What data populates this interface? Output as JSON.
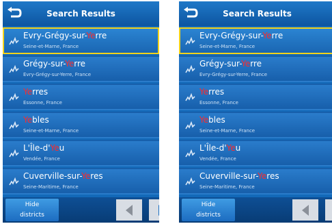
{
  "screens": [
    {
      "header": {
        "title": "Search Results",
        "back_icon": "back-arrow-icon"
      },
      "results": [
        {
          "name_before": "Evry-Grégy-sur-",
          "name_hl": "Ye",
          "name_after": "rre",
          "subtitle": "Seine-et-Marne, France",
          "selected": true,
          "icon": "city-icon"
        },
        {
          "name_before": "Grégy-sur-",
          "name_hl": "Ye",
          "name_after": "rre",
          "subtitle": "Evry-Grégy-sur-Yerre, France",
          "selected": false,
          "icon": "city-icon"
        },
        {
          "name_before": "",
          "name_hl": "Ye",
          "name_after": "rres",
          "subtitle": "Essonne, France",
          "selected": false,
          "icon": "city-icon"
        },
        {
          "name_before": "",
          "name_hl": "Ye",
          "name_after": "bles",
          "subtitle": "Seine-et-Marne, France",
          "selected": false,
          "icon": "city-icon"
        },
        {
          "name_before": "L'Île-d'",
          "name_hl": "Ye",
          "name_after": "u",
          "subtitle": "Vendée, France",
          "selected": false,
          "icon": "city-icon"
        },
        {
          "name_before": "Cuverville-sur-",
          "name_hl": "Ye",
          "name_after": "res",
          "subtitle": "Seine-Maritime, France",
          "selected": false,
          "icon": "city-icon"
        }
      ],
      "footer": {
        "hide_label_1": "Hide",
        "hide_label_2": "districts",
        "prev_icon": "left-arrow-icon",
        "next_icon": "right-arrow-icon"
      }
    },
    {
      "header": {
        "title": "Search Results",
        "back_icon": "back-arrow-icon"
      },
      "results": [
        {
          "name_before": "Evry-Grégy-sur-",
          "name_hl": "Ye",
          "name_after": "rre",
          "subtitle": "Seine-et-Marne, France",
          "selected": true,
          "icon": "city-icon"
        },
        {
          "name_before": "Grégy-sur-",
          "name_hl": "Ye",
          "name_after": "rre",
          "subtitle": "Evry-Grégy-sur-Yerre, France",
          "selected": false,
          "icon": "city-icon"
        },
        {
          "name_before": "",
          "name_hl": "Ye",
          "name_after": "rres",
          "subtitle": "Essonne, France",
          "selected": false,
          "icon": "city-icon"
        },
        {
          "name_before": "",
          "name_hl": "Ye",
          "name_after": "bles",
          "subtitle": "Seine-et-Marne, France",
          "selected": false,
          "icon": "city-icon"
        },
        {
          "name_before": "L'Île-d'",
          "name_hl": "Ye",
          "name_after": "u",
          "subtitle": "Vendée, France",
          "selected": false,
          "icon": "city-icon"
        },
        {
          "name_before": "Cuverville-sur-",
          "name_hl": "Ye",
          "name_after": "res",
          "subtitle": "Seine-Maritime, France",
          "selected": false,
          "icon": "city-icon"
        }
      ],
      "footer": {
        "hide_label_1": "Hide",
        "hide_label_2": "districts",
        "prev_icon": "left-arrow-icon",
        "next_icon": "right-arrow-icon"
      }
    }
  ],
  "colors": {
    "accent_highlight": "#ff2a2a",
    "selection_border": "#f3d21a",
    "background": "#1369b8"
  }
}
